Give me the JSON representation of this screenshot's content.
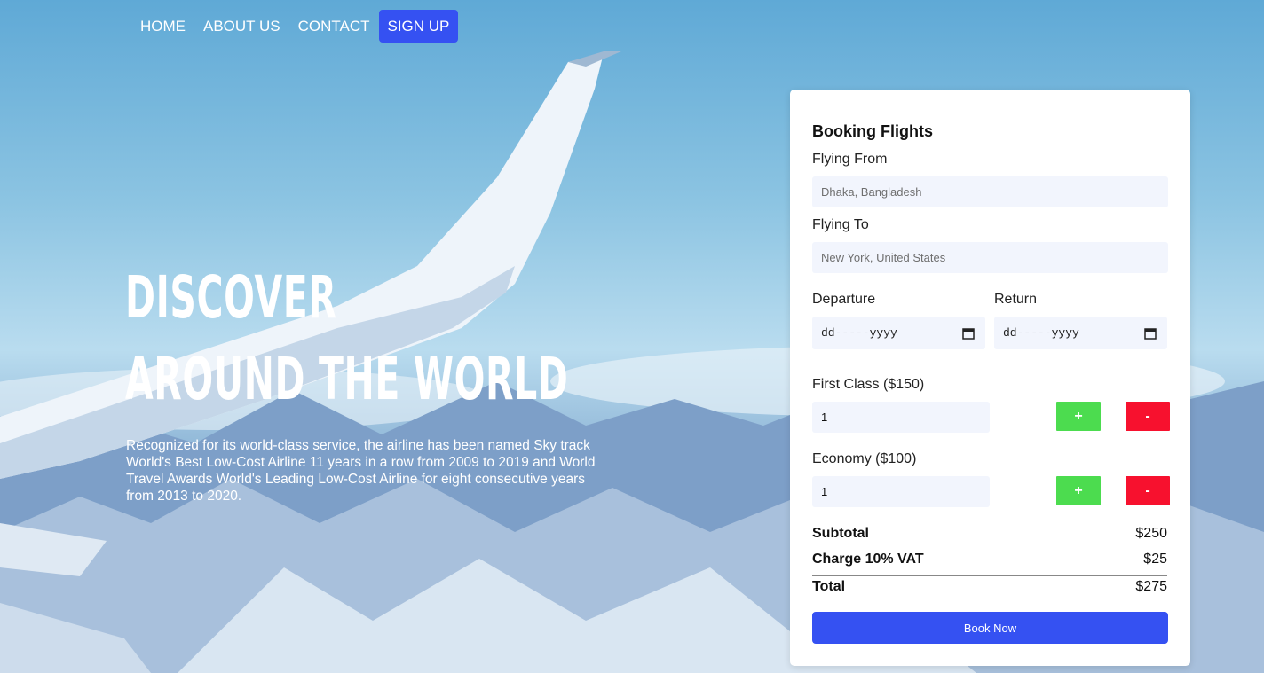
{
  "nav": {
    "home": "HOME",
    "about": "ABOUT US",
    "contact": "CONTACT",
    "signup": "SIGN UP"
  },
  "hero": {
    "line1": "DISCOVER",
    "line2": "AROUND THE WORLD",
    "description": "Recognized for its world-class service, the airline has been named Sky track World's Best Low-Cost Airline 11 years in a row from 2009 to 2019 and World Travel Awards World's Leading Low-Cost Airline for eight consecutive years from 2013 to 2020."
  },
  "booking": {
    "title": "Booking Flights",
    "from_label": "Flying From",
    "from_placeholder": "Dhaka, Bangladesh",
    "to_label": "Flying To",
    "to_placeholder": "New York, United States",
    "departure_label": "Departure",
    "departure_value": "dd-----yyyy",
    "return_label": "Return",
    "return_value": "dd-----yyyy",
    "first_class_label": "First Class ($150)",
    "first_class_qty": "1",
    "economy_label": "Economy ($100)",
    "economy_qty": "1",
    "plus": "+",
    "minus": "-",
    "subtotal_label": "Subtotal",
    "subtotal_value": "$250",
    "vat_label": "Charge 10% VAT",
    "vat_value": "$25",
    "total_label": "Total",
    "total_value": "$275",
    "book_button": "Book Now"
  },
  "colors": {
    "accent": "#3551f2",
    "plus": "#4cdc4f",
    "minus": "#f7112e",
    "field_bg": "#f2f5fd"
  }
}
